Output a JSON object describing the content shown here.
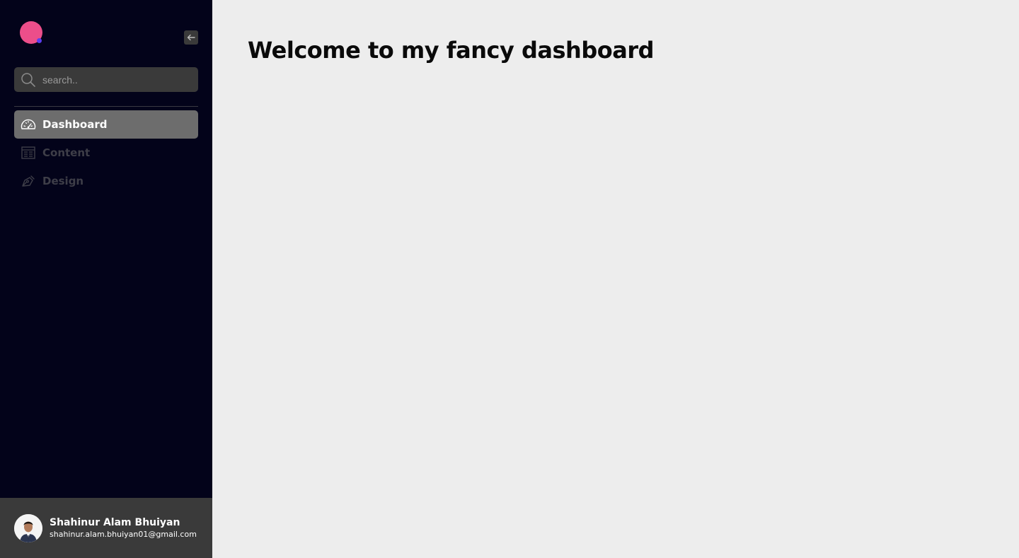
{
  "colors": {
    "sidebar_bg": "#03031a",
    "main_bg": "#ededed",
    "logo": "#ec4e8a",
    "logo_dot": "#5b3df0",
    "active_item_bg": "#6d6d6d",
    "panel_gray": "#3a3a3a"
  },
  "sidebar": {
    "logo_icon": "logo-circle-icon",
    "collapse_icon": "arrow-left-icon",
    "search": {
      "icon": "search-icon",
      "placeholder": "search..",
      "value": ""
    },
    "items": [
      {
        "label": "Dashboard",
        "icon": "speedometer-icon",
        "active": true
      },
      {
        "label": "Content",
        "icon": "table-icon",
        "active": false
      },
      {
        "label": "Design",
        "icon": "pen-nib-icon",
        "active": false
      }
    ]
  },
  "profile": {
    "name": "Shahinur Alam Bhuiyan",
    "email": "shahinur.alam.bhuiyan01@gmail.com",
    "avatar_icon": "user-avatar"
  },
  "main": {
    "title": "Welcome to my fancy dashboard"
  }
}
